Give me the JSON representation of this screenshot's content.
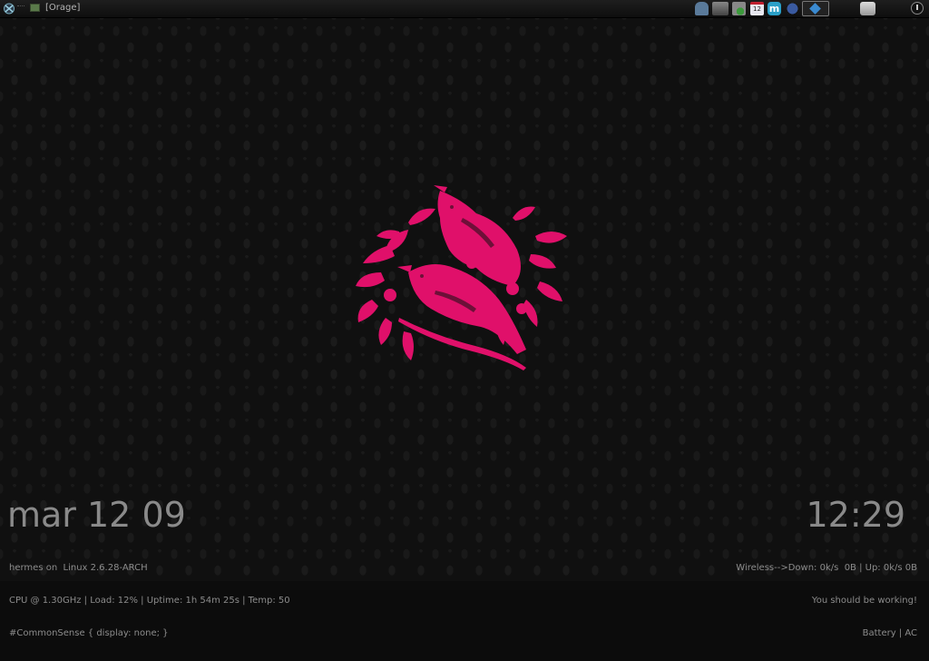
{
  "panel": {
    "task_title": "[Orage]",
    "icons": {
      "menu": "xfce-menu-icon",
      "window": "window-icon",
      "user": "user-icon",
      "network": "network-icon",
      "updates": "update-icon",
      "calendar": "calendar-icon",
      "calendar_day": "12",
      "messenger": "messenger-icon",
      "messenger_letter": "m",
      "dot": "blue-dot-icon",
      "dropbox": "dropbox-icon",
      "battery": "battery-icon",
      "power": "power-icon"
    }
  },
  "conky": {
    "date": "mar 12 09",
    "time": "12:29",
    "system": [
      "hermes on  Linux 2.6.28-ARCH",
      "CPU @ 1.30GHz | Load: 12% | Uptime: 1h 54m 25s | Temp: 50",
      "#CommonSense { display: none; }"
    ],
    "network": [
      "Wireless-->Down: 0k/s  0B | Up: 0k/s 0B",
      "You should be working!",
      "Battery | AC"
    ]
  },
  "colors": {
    "wallpaper": "#101010",
    "art": "#e0106a",
    "text": "#8c8c8c"
  }
}
